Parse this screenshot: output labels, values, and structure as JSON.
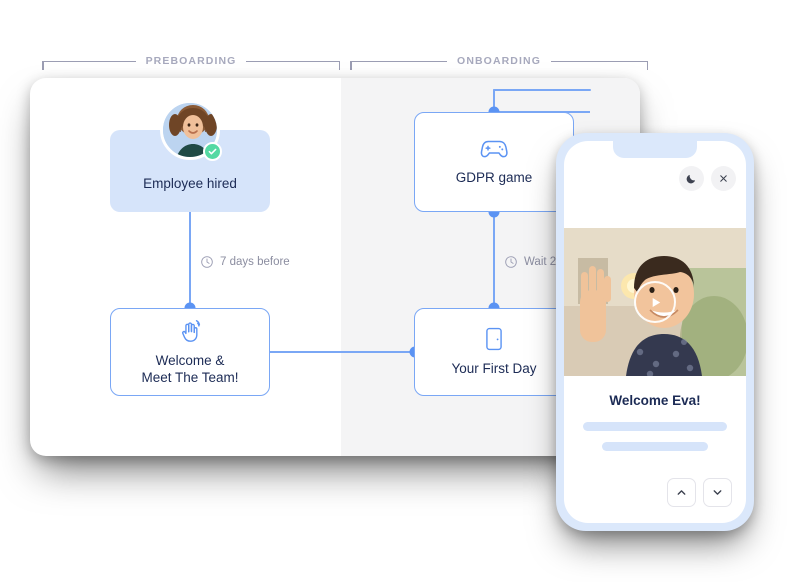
{
  "phases": [
    {
      "label": "PREBOARDING"
    },
    {
      "label": "ONBOARDING"
    }
  ],
  "flow": {
    "nodes": [
      {
        "id": "employee-hired",
        "label": "Employee hired",
        "icon": "avatar-photo",
        "badge": "check-icon",
        "style": "filled"
      },
      {
        "id": "welcome-meet-team",
        "label": "Welcome &\nMeet The Team!",
        "icon": "waving-hand-icon",
        "style": "outlined"
      },
      {
        "id": "gdpr-game",
        "label": "GDPR game",
        "icon": "gamepad-icon",
        "style": "outlined"
      },
      {
        "id": "your-first-day",
        "label": "Your First Day",
        "icon": "door-icon",
        "style": "outlined"
      }
    ],
    "timings": [
      {
        "id": "timing-left",
        "label": "7 days before",
        "icon": "clock-icon"
      },
      {
        "id": "timing-right",
        "label": "Wait 2 day",
        "icon": "clock-icon"
      }
    ]
  },
  "phone": {
    "dark_mode_icon": "moon-icon",
    "close_icon": "close-icon",
    "play_icon": "play-icon",
    "title": "Welcome Eva!",
    "prev_icon": "chevron-up-icon",
    "next_icon": "chevron-down-icon"
  },
  "colors": {
    "accent_blue": "#7aa7f5",
    "node_fill": "#d6e4fa",
    "text_dark": "#1c2b55",
    "muted": "#8b8da0",
    "phase_label": "#a7a9bd",
    "badge_green": "#55d9a3",
    "pane_right": "#f4f4f5",
    "phone_bezel": "#dbe8fb"
  }
}
